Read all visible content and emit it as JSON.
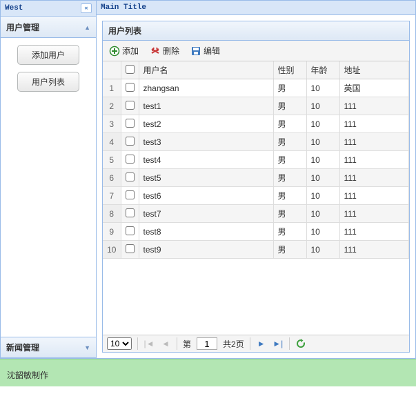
{
  "west": {
    "title": "West",
    "accordion1": {
      "title": "用户管理",
      "btn_add": "添加用户",
      "btn_list": "用户列表"
    },
    "accordion2": {
      "title": "新闻管理"
    }
  },
  "center": {
    "main_title": "Main Title",
    "panel_title": "用户列表",
    "toolbar": {
      "add": "添加",
      "del": "删除",
      "edit": "编辑"
    },
    "columns": {
      "username": "用户名",
      "gender": "性别",
      "age": "年龄",
      "address": "地址"
    },
    "rows": [
      {
        "n": "1",
        "username": "zhangsan",
        "gender": "男",
        "age": "10",
        "address": "英国"
      },
      {
        "n": "2",
        "username": "test1",
        "gender": "男",
        "age": "10",
        "address": "111"
      },
      {
        "n": "3",
        "username": "test2",
        "gender": "男",
        "age": "10",
        "address": "111"
      },
      {
        "n": "4",
        "username": "test3",
        "gender": "男",
        "age": "10",
        "address": "111"
      },
      {
        "n": "5",
        "username": "test4",
        "gender": "男",
        "age": "10",
        "address": "111"
      },
      {
        "n": "6",
        "username": "test5",
        "gender": "男",
        "age": "10",
        "address": "111"
      },
      {
        "n": "7",
        "username": "test6",
        "gender": "男",
        "age": "10",
        "address": "111"
      },
      {
        "n": "8",
        "username": "test7",
        "gender": "男",
        "age": "10",
        "address": "111"
      },
      {
        "n": "9",
        "username": "test8",
        "gender": "男",
        "age": "10",
        "address": "111"
      },
      {
        "n": "10",
        "username": "test9",
        "gender": "男",
        "age": "10",
        "address": "111"
      }
    ],
    "pager": {
      "page_size": "10",
      "label_prefix": "第",
      "current": "1",
      "total_label": "共2页"
    }
  },
  "footer": {
    "text": "沈韶敏制作"
  }
}
